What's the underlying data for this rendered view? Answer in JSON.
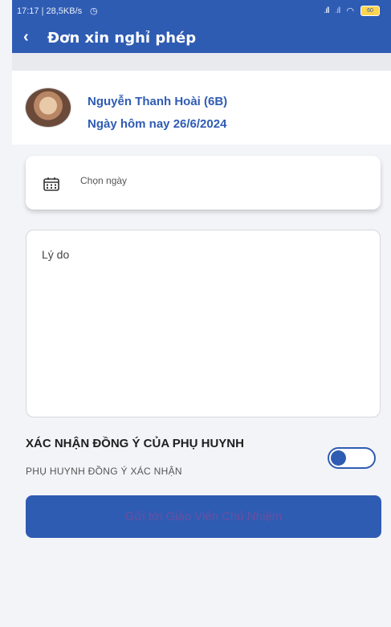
{
  "status_bar": {
    "time_info": "17:17 | 28,5KB/s",
    "alarm_icon": "alarm-clock-icon",
    "signal": ".ıll",
    "battery": "60"
  },
  "header": {
    "title": "Đơn xin nghỉ phép",
    "back_icon": "chevron-left-icon"
  },
  "profile": {
    "name": "Nguyễn Thanh Hoài (6B)",
    "today": "Ngày hôm nay 26/6/2024"
  },
  "date_picker": {
    "placeholder": "Chọn ngày",
    "icon": "calendar-icon"
  },
  "reason": {
    "placeholder": "Lý do"
  },
  "confirmation": {
    "title": "XÁC NHẬN ĐỒNG Ý CỦA PHỤ HUYNH",
    "subtitle": "PHỤ HUYNH ĐỒNG Ý XÁC NHẬN",
    "toggle_state": "off"
  },
  "submit": {
    "label": "Gửi tới Giáo Viên Chủ Nhiệm"
  },
  "colors": {
    "primary": "#2f5cb3",
    "background": "#f3f4f8",
    "submit_text": "#6a4fa0"
  }
}
